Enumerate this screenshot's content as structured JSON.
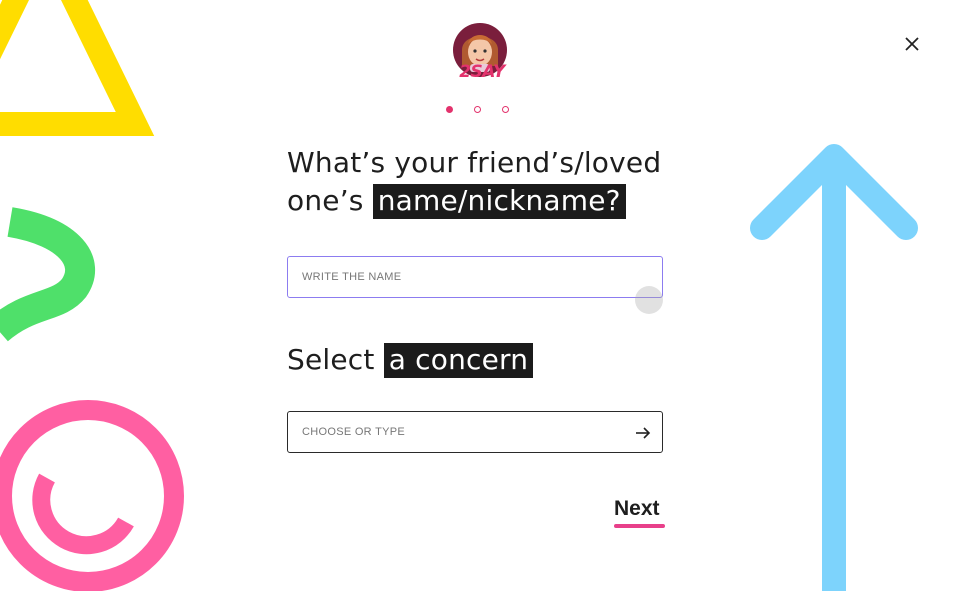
{
  "header": {
    "logo_text": "2SAY",
    "steps": [
      {
        "active": true
      },
      {
        "active": false
      },
      {
        "active": false
      }
    ],
    "close_icon": "close-icon"
  },
  "form": {
    "name_question": {
      "prefix": "What’s your friend’s/loved one’s",
      "highlight": "name/nickname?"
    },
    "name_input": {
      "placeholder": "WRITE THE NAME",
      "value": ""
    },
    "concern_question": {
      "prefix": "Select",
      "highlight": "a concern"
    },
    "concern_input": {
      "placeholder": "CHOOSE OR TYPE",
      "value": "",
      "icon": "arrow-right-icon"
    },
    "next_label": "Next"
  },
  "colors": {
    "accent": "#e3336d",
    "yellow": "#ffdd00",
    "green": "#4fe06a",
    "pink": "#ff5fa2",
    "blue": "#7dd3fc",
    "input_focus_border": "#8c7cf0"
  }
}
